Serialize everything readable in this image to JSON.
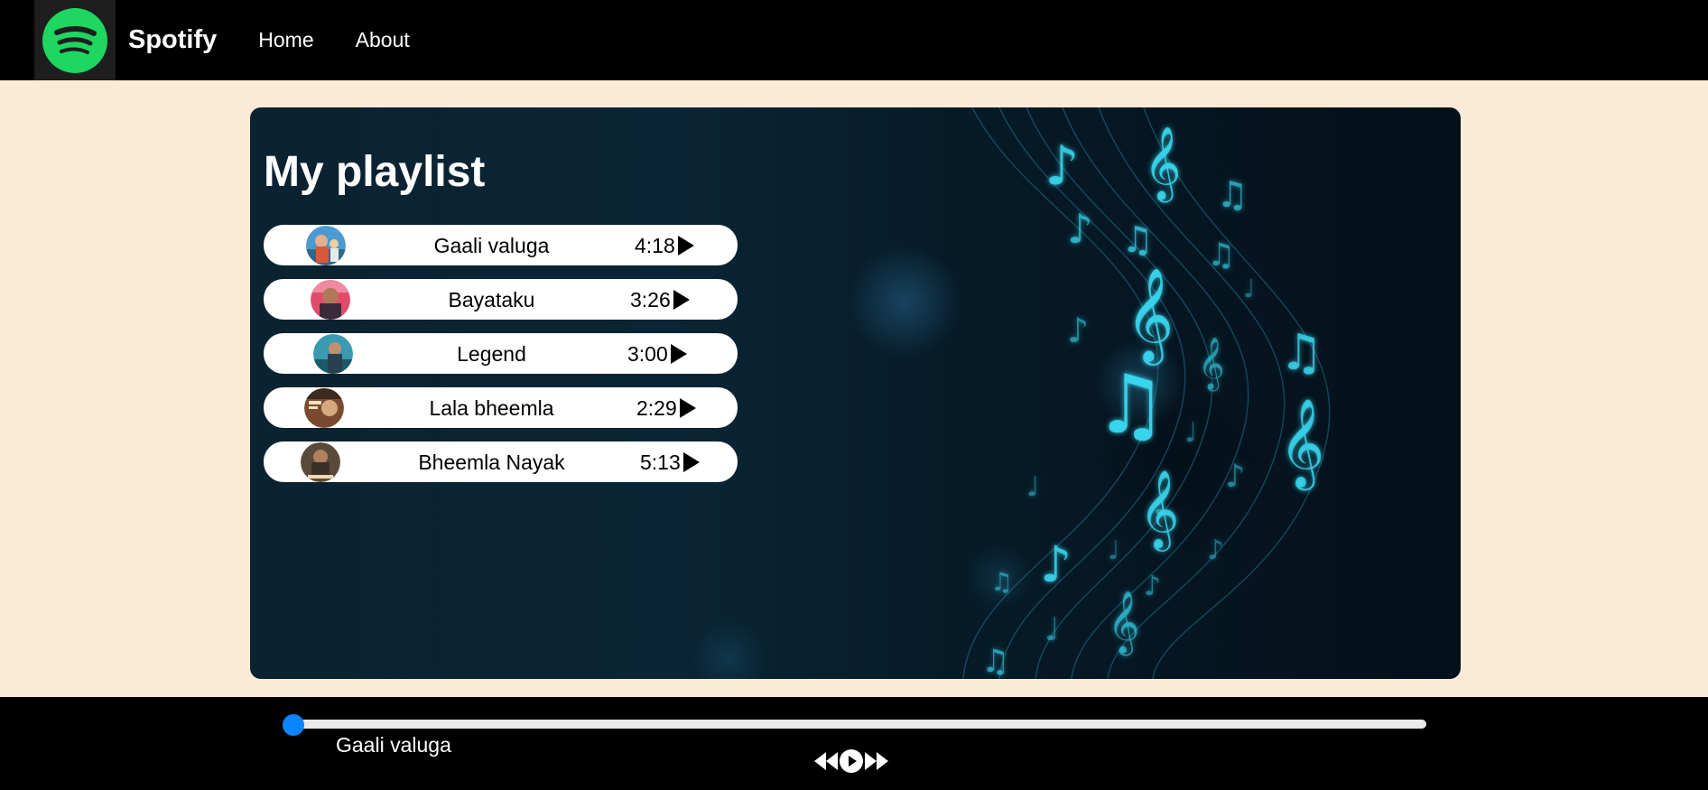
{
  "nav": {
    "brand": "Spotify",
    "links": [
      "Home",
      "About"
    ],
    "logo_icon": "spotify-logo-icon",
    "logo_color": "#1ed760"
  },
  "playlist": {
    "title": "My playlist",
    "songs": [
      {
        "name": "Gaali valuga",
        "duration": "4:18"
      },
      {
        "name": "Bayataku",
        "duration": "3:26"
      },
      {
        "name": "Legend",
        "duration": "3:00"
      },
      {
        "name": "Lala bheemla",
        "duration": "2:29"
      },
      {
        "name": "Bheemla Nayak",
        "duration": "5:13"
      }
    ]
  },
  "player": {
    "now_playing": "Gaali valuga",
    "progress_percent": 0,
    "accent_color": "#0a84ff",
    "controls": [
      "previous-icon",
      "play-icon",
      "next-icon"
    ]
  }
}
